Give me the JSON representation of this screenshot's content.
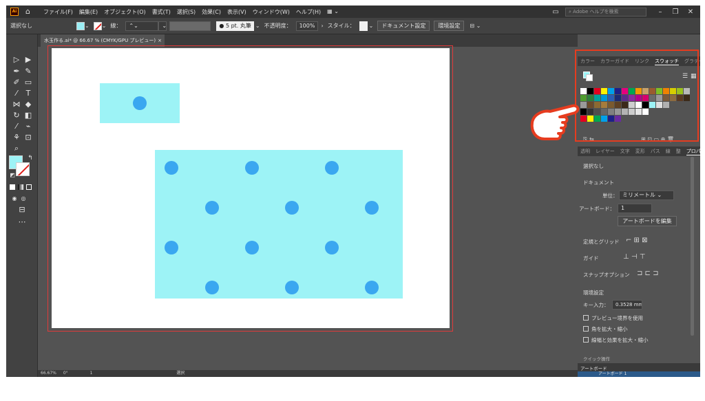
{
  "menubar": {
    "app_icon": "Ai",
    "items": [
      "ファイル(F)",
      "編集(E)",
      "オブジェクト(O)",
      "書式(T)",
      "選択(S)",
      "効果(C)",
      "表示(V)",
      "ウィンドウ(W)",
      "ヘルプ(H)"
    ],
    "help_search_placeholder": "Adobe ヘルプを検索"
  },
  "controlbar": {
    "selection": "選択なし",
    "stroke_label": "線：",
    "brush": "5 pt. 丸筆",
    "opacity_label": "不透明度：",
    "opacity_value": "100%",
    "style_label": "スタイル：",
    "doc_settings": "ドキュメント設定",
    "prefs": "環境設定"
  },
  "document_tab": {
    "title": "水玉作る.ai* @ 66.67 % (CMYK/GPU プレビュー)",
    "close": "×"
  },
  "statusbar": {
    "zoom": "66.67%",
    "rotation": "0°",
    "artboard_num": "1",
    "tool": "選択"
  },
  "panel": {
    "tabs": [
      "カラー",
      "カラーガイド",
      "リンク",
      "スウォッチ",
      "グラデーション"
    ],
    "active_tab": "スウォッチ",
    "tabs2": [
      "透明",
      "レイヤー",
      "文字",
      "変形",
      "パス",
      "線",
      "整",
      "プロパティ"
    ],
    "active_tab2": "プロパティ",
    "none_selected": "選択なし",
    "document_heading": "ドキュメント",
    "unit_label": "単位：",
    "unit_value": "ミリメートル",
    "artboard_label": "アートボード：",
    "artboard_value": "1",
    "edit_artboard": "アートボードを編集",
    "ruler_grid": "定規とグリッド",
    "guides": "ガイド",
    "snap_options": "スナップオプション",
    "prefs_heading": "環境設定",
    "key_input_label": "キー入力：",
    "key_input_value": "0.3528 mm",
    "opt_preview_bounds": "プレビュー境界を使用",
    "opt_scale_corners": "角を拡大・縮小",
    "opt_scale_strokes": "線幅と効果を拡大・縮小",
    "quick_actions": "クイック操作",
    "bottom_panel_tab": "アートボード",
    "bottom_panel_row": "アートボード 1"
  },
  "colors": {
    "accent_highlight": "#e63c1f",
    "shape_fill": "#9df3f6",
    "dot_fill": "#3aa7f0"
  },
  "swatches": [
    [
      "#ffffff",
      "#000000",
      "#e3001f",
      "#fff100",
      "#00a0e9",
      "#1d2088",
      "#e4007f",
      "#00a650",
      "#f39800",
      "#c6a16b",
      "#9a5b2f",
      "#7fbe26",
      "#ef8200",
      "#d7ce00",
      "#9ac21c",
      "#b9b9b9"
    ],
    [
      "#4f9d2f",
      "#2d7f3a",
      "#00a29a",
      "#0097d8",
      "#2a5db4",
      "#1b2a74",
      "#5a2b8c",
      "#8b2aa0",
      "#b5008a",
      "#d6006c",
      "#6b6b6b",
      "#9a9a9a",
      "#7a5a3a",
      "#8c6b3f",
      "#5b3a22",
      "#3c2a1a"
    ],
    [
      "#9a9a9a",
      "#6a4a2a",
      "#8c6a32",
      "#a67c3c",
      "#7b5a2f",
      "#5e4023",
      "#3c2a1a",
      "#cfcfcf",
      "#ffffff",
      "#000000",
      "#9df3f6",
      "#e0e0e0",
      "#b0b0b0"
    ],
    [
      "#000000",
      "#333333",
      "#4d4d4d",
      "#666666",
      "#808080",
      "#999999",
      "#b3b3b3",
      "#cccccc",
      "#e6e6e6",
      "#ffffff"
    ],
    [
      "#e3001f",
      "#fff100",
      "#00a650",
      "#00a0e9",
      "#1d2088",
      "#6a2aa0"
    ]
  ],
  "icons": {
    "home": "home-icon",
    "hand_pointer": "hand-pointer-icon"
  }
}
